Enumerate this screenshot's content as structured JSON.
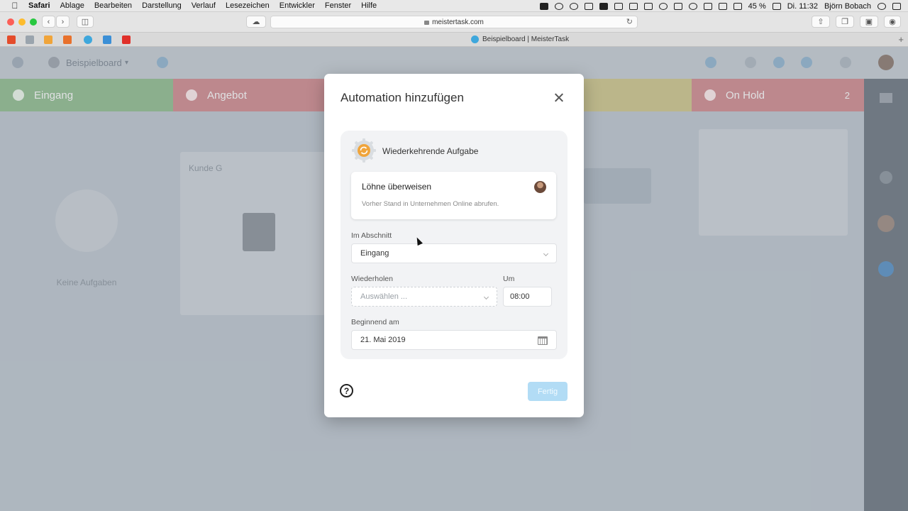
{
  "menubar": {
    "app": "Safari",
    "items": [
      "Ablage",
      "Bearbeiten",
      "Darstellung",
      "Verlauf",
      "Lesezeichen",
      "Entwickler",
      "Fenster",
      "Hilfe"
    ],
    "battery": "45 %",
    "clock": "Di. 11:32",
    "user": "Björn Bobach"
  },
  "browser": {
    "url": "meistertask.com",
    "tab_title": "Beispielboard | MeisterTask"
  },
  "app": {
    "board_name": "Beispielboard",
    "columns": [
      {
        "name": "Eingang",
        "color": "#8fc48a"
      },
      {
        "name": "Angebot",
        "color": "#e58a8c"
      },
      {
        "name": "On Hold",
        "color": "#e58a8c",
        "count": "2"
      }
    ],
    "empty_state_title": "Keine Aufgaben",
    "card_title": "Kunde G"
  },
  "modal": {
    "title": "Automation hinzufügen",
    "automation_type": "Wiederkehrende Aufgabe",
    "task": {
      "name": "Löhne überweisen",
      "description": "Vorher Stand in Unternehmen Online abrufen."
    },
    "section": {
      "label": "Im Abschnitt",
      "value": "Eingang"
    },
    "repeat": {
      "label": "Wiederholen",
      "placeholder": "Auswählen ..."
    },
    "time": {
      "label": "Um",
      "value": "08:00"
    },
    "start": {
      "label": "Beginnend am",
      "value": "21. Mai 2019"
    },
    "help_symbol": "?",
    "done_label": "Fertig"
  },
  "colors": {
    "accent": "#3ea7dc",
    "done_disabled": "#b2dcf5",
    "gear": "#f0a43a"
  }
}
